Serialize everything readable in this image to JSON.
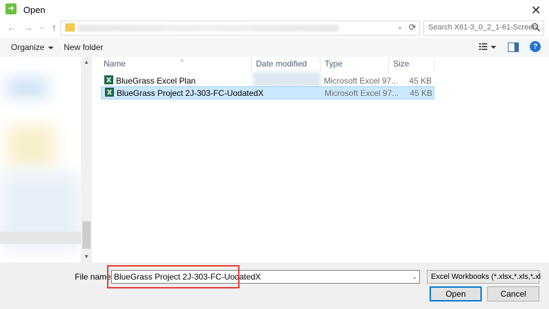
{
  "window": {
    "title": "Open",
    "close_glyph": "✕"
  },
  "nav": {
    "back": "←",
    "forward": "→",
    "dropdown": "⌄",
    "up": "↑",
    "refresh": "⟳",
    "address_dropdown": "⌄"
  },
  "search": {
    "placeholder": "Search X61-3_0_2_1-61-Screen..."
  },
  "toolbar": {
    "organize_label": "Organize",
    "new_folder_label": "New folder",
    "help_glyph": "?"
  },
  "scrollbar": {
    "up": "▲",
    "down": "▼"
  },
  "columns": {
    "name": "Name",
    "date_modified": "Date modified",
    "type": "Type",
    "size": "Size",
    "sort_arrow": "^"
  },
  "files": [
    {
      "name": "BlueGrass Excel Plan",
      "type": "Microsoft Excel 97...",
      "size": "45 KB",
      "selected": false
    },
    {
      "name": "BlueGrass Project 2J-303-FC-UodatedX",
      "type": "Microsoft Excel 97...",
      "size": "45 KB",
      "selected": true
    }
  ],
  "bottom": {
    "file_name_label": "File name:",
    "file_name_value": "BlueGrass Project 2J-303-FC-UodatedX",
    "file_type_filter": "Excel Workbooks (*.xlsx,*.xls,*.xl",
    "open_label": "Open",
    "cancel_label": "Cancel",
    "dropdown_glyph": "⌄"
  },
  "colors": {
    "selection_bg": "#cce8ff",
    "highlight_border": "#e53935",
    "primary_border": "#0078d7"
  }
}
